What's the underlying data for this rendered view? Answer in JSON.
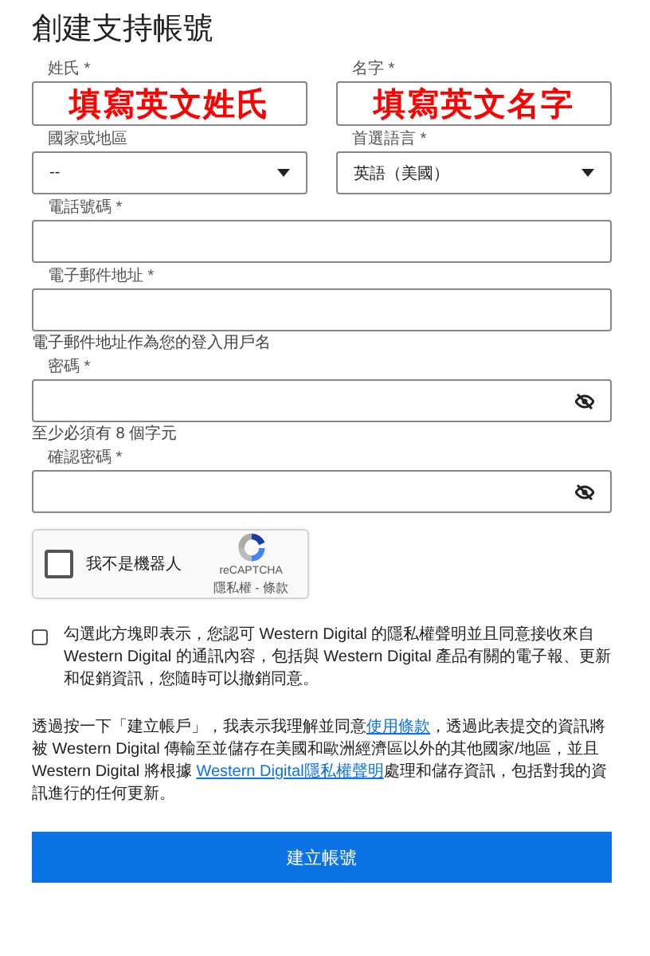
{
  "title": "創建支持帳號",
  "rows": [
    [
      {
        "kind": "overlay",
        "label": "姓氏 *",
        "value": "填寫英文姓氏"
      },
      {
        "kind": "overlay",
        "label": "名字 *",
        "value": "填寫英文名字"
      }
    ],
    [
      {
        "kind": "select",
        "label": "國家或地區",
        "value": "--"
      },
      {
        "kind": "select",
        "label": "首選語言 *",
        "value": "英語（美國）"
      }
    ],
    [
      {
        "kind": "text",
        "label": "電話號碼 *"
      }
    ],
    [
      {
        "kind": "text",
        "label": "電子郵件地址 *",
        "helper": "電子郵件地址作為您的登入用戶名"
      }
    ],
    [
      {
        "kind": "password",
        "label": "密碼 *",
        "helper": "至少必須有 8 個字元"
      }
    ],
    [
      {
        "kind": "password",
        "label": "確認密碼 *"
      }
    ]
  ],
  "captcha": {
    "checked": false,
    "label": "我不是機器人",
    "brand": "reCAPTCHA",
    "links": "隱私權 - 條款"
  },
  "consent": {
    "checked": false,
    "text": "勾選此方塊即表示，您認可 Western Digital 的隱私權聲明並且同意接收來自 Western Digital 的通訊內容，包括與 Western Digital 產品有關的電子報、更新和促銷資訊，您隨時可以撤銷同意。"
  },
  "terms": {
    "before": "透過按一下「建立帳戶」，我表示我理解並同意",
    "link1": "使用條款",
    "middle": "，透過此表提交的資訊將被 Western Digital 傳輸至並儲存在美國和歐洲經濟區以外的其他國家/地區，並且 Western Digital 將根據 ",
    "link2": "Western Digital隱私權聲明",
    "after": "處理和儲存資訊，包括對我的資訊進行的任何更新。"
  },
  "submit": "建立帳號"
}
